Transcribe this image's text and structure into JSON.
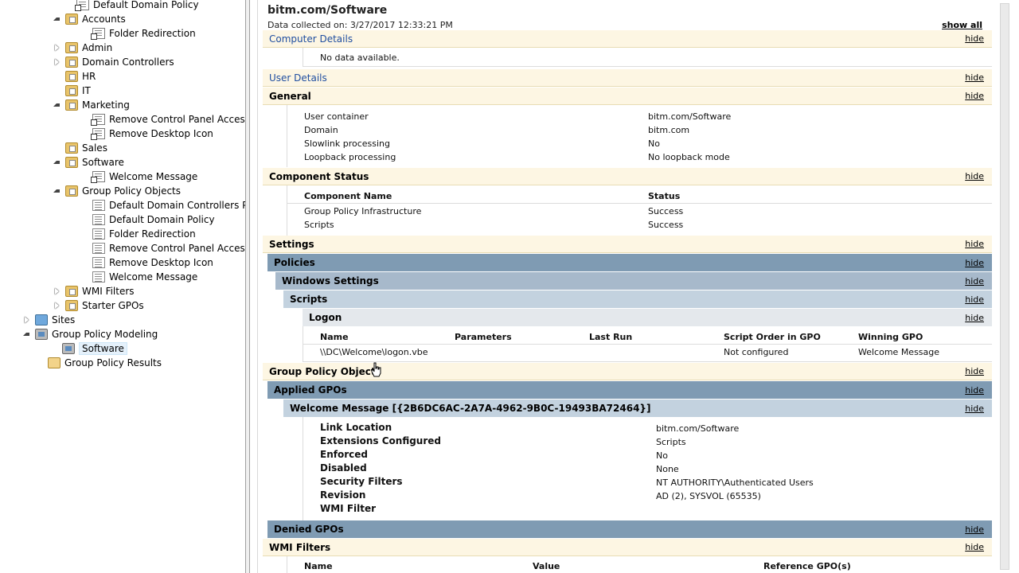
{
  "tree": {
    "items": [
      {
        "label": "Default Domain Policy",
        "icon": "gpolink",
        "arrow": "none"
      },
      {
        "label": "Accounts",
        "icon": "folder",
        "arrow": "open"
      },
      {
        "label": "Folder Redirection",
        "icon": "gpolink",
        "arrow": "none"
      },
      {
        "label": "Admin",
        "icon": "folder",
        "arrow": "closed"
      },
      {
        "label": "Domain Controllers",
        "icon": "folder",
        "arrow": "closed"
      },
      {
        "label": "HR",
        "icon": "folder",
        "arrow": "none"
      },
      {
        "label": "IT",
        "icon": "folder",
        "arrow": "none"
      },
      {
        "label": "Marketing",
        "icon": "folder",
        "arrow": "open"
      },
      {
        "label": "Remove Control Panel Access",
        "icon": "gpolink",
        "arrow": "none"
      },
      {
        "label": "Remove Desktop Icon",
        "icon": "gpolink",
        "arrow": "none"
      },
      {
        "label": "Sales",
        "icon": "folder",
        "arrow": "none"
      },
      {
        "label": "Software",
        "icon": "folder",
        "arrow": "open"
      },
      {
        "label": "Welcome Message",
        "icon": "gpolink",
        "arrow": "none"
      },
      {
        "label": "Group Policy Objects",
        "icon": "folder",
        "arrow": "open"
      },
      {
        "label": "Default Domain Controllers Policy",
        "icon": "gpo",
        "arrow": "none"
      },
      {
        "label": "Default Domain Policy",
        "icon": "gpo",
        "arrow": "none"
      },
      {
        "label": "Folder Redirection",
        "icon": "gpo",
        "arrow": "none"
      },
      {
        "label": "Remove Control Panel Access",
        "icon": "gpo",
        "arrow": "none"
      },
      {
        "label": "Remove Desktop Icon",
        "icon": "gpo",
        "arrow": "none"
      },
      {
        "label": "Welcome Message",
        "icon": "gpo",
        "arrow": "none"
      },
      {
        "label": "WMI Filters",
        "icon": "folder",
        "arrow": "closed"
      },
      {
        "label": "Starter GPOs",
        "icon": "folder",
        "arrow": "closed"
      },
      {
        "label": "Sites",
        "icon": "sites",
        "arrow": "closed"
      },
      {
        "label": "Group Policy Modeling",
        "icon": "model",
        "arrow": "open"
      },
      {
        "label": "Software",
        "icon": "model",
        "arrow": "none"
      },
      {
        "label": "Group Policy Results",
        "icon": "results",
        "arrow": "none"
      }
    ]
  },
  "report": {
    "title": "bitm.com/Software",
    "collected": "Data collected on: 3/27/2017 12:33:21 PM",
    "show_all": "show all",
    "hide": "hide",
    "computer_details": "Computer Details",
    "no_data": "No data available.",
    "user_details": "User Details",
    "general": {
      "title": "General",
      "rows": [
        {
          "k": "User container",
          "v": "bitm.com/Software"
        },
        {
          "k": "Domain",
          "v": "bitm.com"
        },
        {
          "k": "Slowlink processing",
          "v": "No"
        },
        {
          "k": "Loopback processing",
          "v": "No loopback mode"
        }
      ]
    },
    "component_status": {
      "title": "Component Status",
      "h1": "Component Name",
      "h2": "Status",
      "rows": [
        {
          "k": "Group Policy Infrastructure",
          "v": "Success"
        },
        {
          "k": "Scripts",
          "v": "Success"
        }
      ]
    },
    "settings": "Settings",
    "policies": "Policies",
    "windows_settings": "Windows Settings",
    "scripts": "Scripts",
    "logon": {
      "title": "Logon",
      "headers": [
        "Name",
        "Parameters",
        "Last Run",
        "Script Order in GPO",
        "Winning GPO"
      ],
      "row": [
        "\\\\DC\\Welcome\\logon.vbe",
        "",
        "",
        "Not configured",
        "Welcome Message"
      ]
    },
    "gpo_section": "Group Policy Objects",
    "applied_gpos": "Applied GPOs",
    "gpo_name": "Welcome Message [{2B6DC6AC-2A7A-4962-9B0C-19493BA72464}]",
    "gpo_rows": [
      {
        "k": "Link Location",
        "v": "bitm.com/Software"
      },
      {
        "k": "Extensions Configured",
        "v": "Scripts"
      },
      {
        "k": "Enforced",
        "v": "No"
      },
      {
        "k": "Disabled",
        "v": "None"
      },
      {
        "k": "Security Filters",
        "v": "NT AUTHORITY\\Authenticated Users"
      },
      {
        "k": "Revision",
        "v": "AD (2), SYSVOL (65535)"
      },
      {
        "k": "WMI Filter",
        "v": ""
      }
    ],
    "denied_gpos": "Denied GPOs",
    "wmi_filters": {
      "title": "WMI Filters",
      "headers": [
        "Name",
        "Value",
        "Reference GPO(s)"
      ]
    }
  }
}
